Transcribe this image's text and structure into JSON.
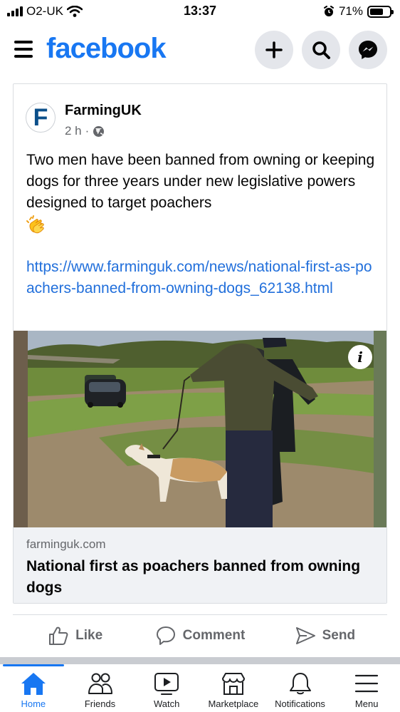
{
  "status_bar": {
    "carrier": "O2-UK",
    "time": "13:37",
    "battery_percent": "71%",
    "battery_level": 0.71
  },
  "header": {
    "logo": "facebook"
  },
  "post": {
    "page_name": "FarmingUK",
    "avatar_letter": "F",
    "time_ago": "2 h",
    "separator": "·",
    "text": "Two men have been banned from owning or keeping dogs for three years under new legislative powers designed to target poachers",
    "emoji": "clapping-hands",
    "link": "https://www.farminguk.com/news/national-first-as-poachers-banned-from-owning-dogs_62138.html",
    "info_icon_label": "i",
    "link_preview": {
      "domain": "farminguk.com",
      "title": "National first as poachers banned from owning dogs"
    }
  },
  "actions": {
    "like": "Like",
    "comment": "Comment",
    "send": "Send"
  },
  "tabs": [
    {
      "label": "Home",
      "icon": "home-icon",
      "active": true
    },
    {
      "label": "Friends",
      "icon": "friends-icon",
      "active": false
    },
    {
      "label": "Watch",
      "icon": "watch-icon",
      "active": false
    },
    {
      "label": "Marketplace",
      "icon": "marketplace-icon",
      "active": false
    },
    {
      "label": "Notifications",
      "icon": "bell-icon",
      "active": false
    },
    {
      "label": "Menu",
      "icon": "menu-icon",
      "active": false
    }
  ],
  "colors": {
    "brand": "#1877f2",
    "link": "#216fdb",
    "muted": "#65676b"
  }
}
